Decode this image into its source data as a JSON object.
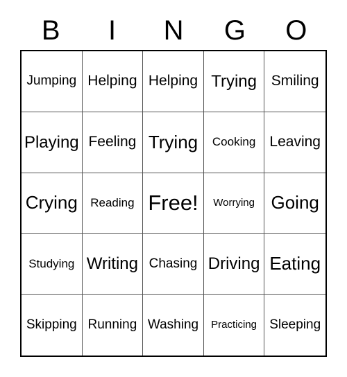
{
  "card": {
    "type": "bingo-card",
    "columns": 5,
    "rows": 5,
    "background_color": "#ffffff",
    "text_color": "#000000",
    "border_color": "#000000",
    "gridline_color": "#555555"
  },
  "header": {
    "letters": [
      {
        "label": "B"
      },
      {
        "label": "I"
      },
      {
        "label": "N"
      },
      {
        "label": "G"
      },
      {
        "label": "O"
      }
    ]
  },
  "grid": {
    "cells": [
      {
        "label": "Jumping",
        "size": "fs-m"
      },
      {
        "label": "Helping",
        "size": "fs-l"
      },
      {
        "label": "Helping",
        "size": "fs-l"
      },
      {
        "label": "Trying",
        "size": "fs-xl"
      },
      {
        "label": "Smiling",
        "size": "fs-l"
      },
      {
        "label": "Playing",
        "size": "fs-xl"
      },
      {
        "label": "Feeling",
        "size": "fs-l"
      },
      {
        "label": "Trying",
        "size": "fs-xxl"
      },
      {
        "label": "Cooking",
        "size": "fs-s"
      },
      {
        "label": "Leaving",
        "size": "fs-l"
      },
      {
        "label": "Crying",
        "size": "fs-xxl"
      },
      {
        "label": "Reading",
        "size": "fs-s"
      },
      {
        "label": "Free!",
        "size": "fs-free"
      },
      {
        "label": "Worrying",
        "size": "fs-xs"
      },
      {
        "label": "Going",
        "size": "fs-xxl"
      },
      {
        "label": "Studying",
        "size": "fs-s"
      },
      {
        "label": "Writing",
        "size": "fs-xl"
      },
      {
        "label": "Chasing",
        "size": "fs-m"
      },
      {
        "label": "Driving",
        "size": "fs-xl"
      },
      {
        "label": "Eating",
        "size": "fs-xxl"
      },
      {
        "label": "Skipping",
        "size": "fs-m"
      },
      {
        "label": "Running",
        "size": "fs-m"
      },
      {
        "label": "Washing",
        "size": "fs-m"
      },
      {
        "label": "Practicing",
        "size": "fs-xs"
      },
      {
        "label": "Sleeping",
        "size": "fs-m"
      }
    ]
  }
}
